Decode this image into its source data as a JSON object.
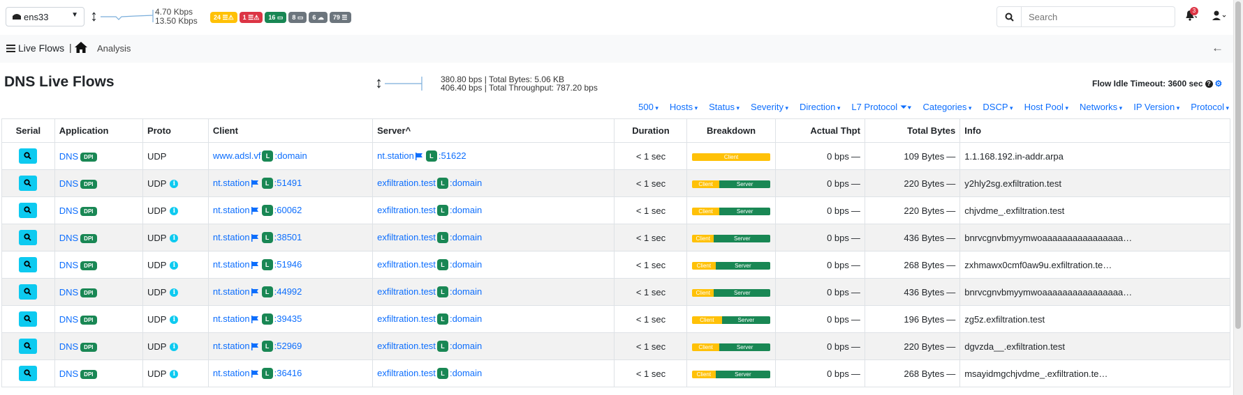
{
  "topbar": {
    "interface": "ens33",
    "rate_up": "4.70 Kbps",
    "rate_down": "13.50 Kbps",
    "badges": [
      {
        "count": "24",
        "icon": "warning-list-icon",
        "color": "#ffc107"
      },
      {
        "count": "1",
        "icon": "error-list-icon",
        "color": "#dc3545"
      },
      {
        "count": "16",
        "icon": "laptop-icon",
        "color": "#198754"
      },
      {
        "count": "8",
        "icon": "laptop-icon",
        "color": "#6c757d"
      },
      {
        "count": "6",
        "icon": "cloud-icon",
        "color": "#6c757d"
      },
      {
        "count": "79",
        "icon": "list-icon",
        "color": "#6c757d"
      }
    ],
    "search_placeholder": "Search",
    "notification_count": "3"
  },
  "breadcrumb": {
    "live_flows": "Live Flows",
    "analysis": "Analysis"
  },
  "header": {
    "title": "DNS Live Flows",
    "throughput_line1": "380.80 bps | Total Bytes: 5.06 KB",
    "throughput_line2": "406.40 bps | Total Throughput: 787.20 bps",
    "idle_timeout": "Flow Idle Timeout: 3600 sec"
  },
  "filters": [
    "500",
    "Hosts",
    "Status",
    "Severity",
    "Direction",
    "L7 Protocol",
    "Categories",
    "DSCP",
    "Host Pool",
    "Networks",
    "IP Version",
    "Protocol"
  ],
  "table": {
    "columns": [
      "Serial",
      "Application",
      "Proto",
      "Client",
      "Server^",
      "Duration",
      "Breakdown",
      "Actual Thpt",
      "Total Bytes",
      "Info"
    ],
    "rows": [
      {
        "app": "DNS",
        "proto": "UDP",
        "proto_info": false,
        "client_host": "www.adsl.vf",
        "client_flag": false,
        "client_port": "domain",
        "server_host": "nt.station",
        "server_flag": true,
        "server_port": "51622",
        "duration": "< 1 sec",
        "client_pct": 100,
        "thpt": "0 bps",
        "bytes": "109 Bytes",
        "info": "1.1.168.192.in-addr.arpa"
      },
      {
        "app": "DNS",
        "proto": "UDP",
        "proto_info": true,
        "client_host": "nt.station",
        "client_flag": true,
        "client_port": "51491",
        "server_host": "exfiltration.test",
        "server_flag": false,
        "server_port": "domain",
        "duration": "< 1 sec",
        "client_pct": 35,
        "thpt": "0 bps",
        "bytes": "220 Bytes",
        "info": "y2hly2sg.exfiltration.test"
      },
      {
        "app": "DNS",
        "proto": "UDP",
        "proto_info": true,
        "client_host": "nt.station",
        "client_flag": true,
        "client_port": "60062",
        "server_host": "exfiltration.test",
        "server_flag": false,
        "server_port": "domain",
        "duration": "< 1 sec",
        "client_pct": 35,
        "thpt": "0 bps",
        "bytes": "220 Bytes",
        "info": "chjvdme_.exfiltration.test"
      },
      {
        "app": "DNS",
        "proto": "UDP",
        "proto_info": true,
        "client_host": "nt.station",
        "client_flag": true,
        "client_port": "38501",
        "server_host": "exfiltration.test",
        "server_flag": false,
        "server_port": "domain",
        "duration": "< 1 sec",
        "client_pct": 28,
        "thpt": "0 bps",
        "bytes": "436 Bytes",
        "info": "bnrvcgnvbmyymwoaaaaaaaaaaaaaaaa…"
      },
      {
        "app": "DNS",
        "proto": "UDP",
        "proto_info": true,
        "client_host": "nt.station",
        "client_flag": true,
        "client_port": "51946",
        "server_host": "exfiltration.test",
        "server_flag": false,
        "server_port": "domain",
        "duration": "< 1 sec",
        "client_pct": 30,
        "thpt": "0 bps",
        "bytes": "268 Bytes",
        "info": "zxhmawx0cmf0aw9u.exfiltration.te…"
      },
      {
        "app": "DNS",
        "proto": "UDP",
        "proto_info": true,
        "client_host": "nt.station",
        "client_flag": true,
        "client_port": "44992",
        "server_host": "exfiltration.test",
        "server_flag": false,
        "server_port": "domain",
        "duration": "< 1 sec",
        "client_pct": 28,
        "thpt": "0 bps",
        "bytes": "436 Bytes",
        "info": "bnrvcgnvbmyymwoaaaaaaaaaaaaaaaa…"
      },
      {
        "app": "DNS",
        "proto": "UDP",
        "proto_info": true,
        "client_host": "nt.station",
        "client_flag": true,
        "client_port": "39435",
        "server_host": "exfiltration.test",
        "server_flag": false,
        "server_port": "domain",
        "duration": "< 1 sec",
        "client_pct": 38,
        "thpt": "0 bps",
        "bytes": "196 Bytes",
        "info": "zg5z.exfiltration.test"
      },
      {
        "app": "DNS",
        "proto": "UDP",
        "proto_info": true,
        "client_host": "nt.station",
        "client_flag": true,
        "client_port": "52969",
        "server_host": "exfiltration.test",
        "server_flag": false,
        "server_port": "domain",
        "duration": "< 1 sec",
        "client_pct": 35,
        "thpt": "0 bps",
        "bytes": "220 Bytes",
        "info": "dgvzda__.exfiltration.test"
      },
      {
        "app": "DNS",
        "proto": "UDP",
        "proto_info": true,
        "client_host": "nt.station",
        "client_flag": true,
        "client_port": "36416",
        "server_host": "exfiltration.test",
        "server_flag": false,
        "server_port": "domain",
        "duration": "< 1 sec",
        "client_pct": 30,
        "thpt": "0 bps",
        "bytes": "268 Bytes",
        "info": "msayidmgchjvdme_.exfiltration.te…"
      }
    ],
    "dpi_label": "DPI",
    "local_label": "L",
    "bar_client": "Client",
    "bar_server": "Server"
  }
}
